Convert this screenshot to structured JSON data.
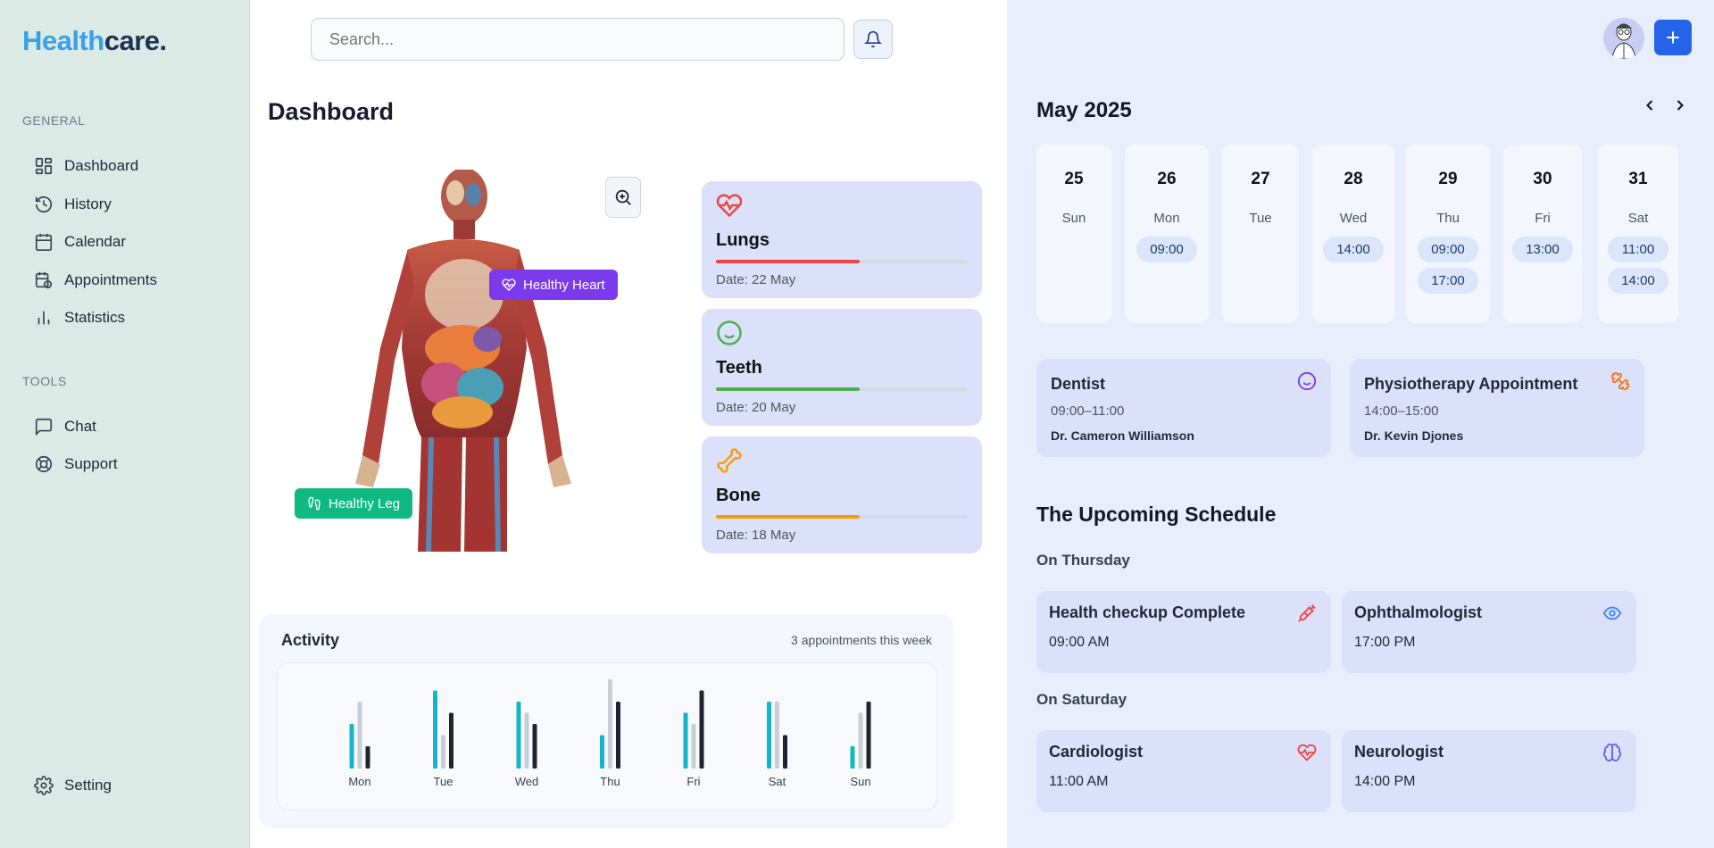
{
  "logo": {
    "part1": "Health",
    "part2": "care."
  },
  "sidebar": {
    "general_title": "GENERAL",
    "tools_title": "TOOLS",
    "items": [
      {
        "label": "Dashboard",
        "icon": "dashboard-icon"
      },
      {
        "label": "History",
        "icon": "history-icon"
      },
      {
        "label": "Calendar",
        "icon": "calendar-icon"
      },
      {
        "label": "Appointments",
        "icon": "appointments-icon"
      },
      {
        "label": "Statistics",
        "icon": "statistics-icon"
      }
    ],
    "tools": [
      {
        "label": "Chat",
        "icon": "chat-icon"
      },
      {
        "label": "Support",
        "icon": "support-icon"
      }
    ],
    "setting_label": "Setting"
  },
  "search": {
    "placeholder": "Search..."
  },
  "main": {
    "title": "Dashboard",
    "body_tags": {
      "heart": "Healthy Heart",
      "leg": "Healthy Leg"
    },
    "cards": [
      {
        "name": "Lungs",
        "date": "Date: 22 May",
        "icon": "heart-pulse-icon",
        "color": "#ef4444",
        "progress": 0.57
      },
      {
        "name": "Teeth",
        "date": "Date: 20 May",
        "icon": "smile-icon",
        "color": "#4caf50",
        "progress": 0.57
      },
      {
        "name": "Bone",
        "date": "Date: 18 May",
        "icon": "bone-icon",
        "color": "#f59e0b",
        "progress": 0.57
      }
    ]
  },
  "activity": {
    "title": "Activity",
    "subtitle": "3 appointments this week"
  },
  "chart_data": {
    "type": "bar",
    "categories": [
      "Mon",
      "Tue",
      "Wed",
      "Thu",
      "Fri",
      "Sat",
      "Sun"
    ],
    "series": [
      {
        "values": [
          4,
          7,
          6,
          3,
          5,
          6,
          2
        ],
        "color": "#17b3c9"
      },
      {
        "values": [
          6,
          3,
          5,
          8,
          4,
          6,
          5
        ],
        "color": "#c9ced6"
      },
      {
        "values": [
          2,
          5,
          4,
          6,
          7,
          3,
          6
        ],
        "color": "#1f2530"
      }
    ]
  },
  "calendar": {
    "month": "May 2025",
    "days": [
      {
        "num": "25",
        "wd": "Sun",
        "times": []
      },
      {
        "num": "26",
        "wd": "Mon",
        "times": [
          "09:00"
        ]
      },
      {
        "num": "27",
        "wd": "Tue",
        "times": []
      },
      {
        "num": "28",
        "wd": "Wed",
        "times": [
          "14:00"
        ]
      },
      {
        "num": "29",
        "wd": "Thu",
        "times": [
          "09:00",
          "17:00"
        ]
      },
      {
        "num": "30",
        "wd": "Fri",
        "times": [
          "13:00"
        ]
      },
      {
        "num": "31",
        "wd": "Sat",
        "times": [
          "11:00",
          "14:00"
        ]
      }
    ]
  },
  "appointments": [
    {
      "title": "Dentist",
      "time": "09:00–11:00",
      "doctor": "Dr. Cameron Williamson",
      "icon": "smile-icon"
    },
    {
      "title": "Physiotherapy Appointment",
      "time": "14:00–15:00",
      "doctor": "Dr. Kevin Djones",
      "icon": "dumbbell-icon"
    }
  ],
  "upcoming": {
    "title": "The Upcoming Schedule",
    "thursday_label": "On Thursday",
    "saturday_label": "On Saturday",
    "thursday": [
      {
        "title": "Health checkup Complete",
        "time": "09:00 AM",
        "icon": "syringe-icon"
      },
      {
        "title": "Ophthalmologist",
        "time": "17:00 PM",
        "icon": "eye-icon"
      }
    ],
    "saturday": [
      {
        "title": "Cardiologist",
        "time": "11:00 AM",
        "icon": "heart-pulse-icon"
      },
      {
        "title": "Neurologist",
        "time": "14:00 PM",
        "icon": "brain-icon"
      }
    ]
  }
}
